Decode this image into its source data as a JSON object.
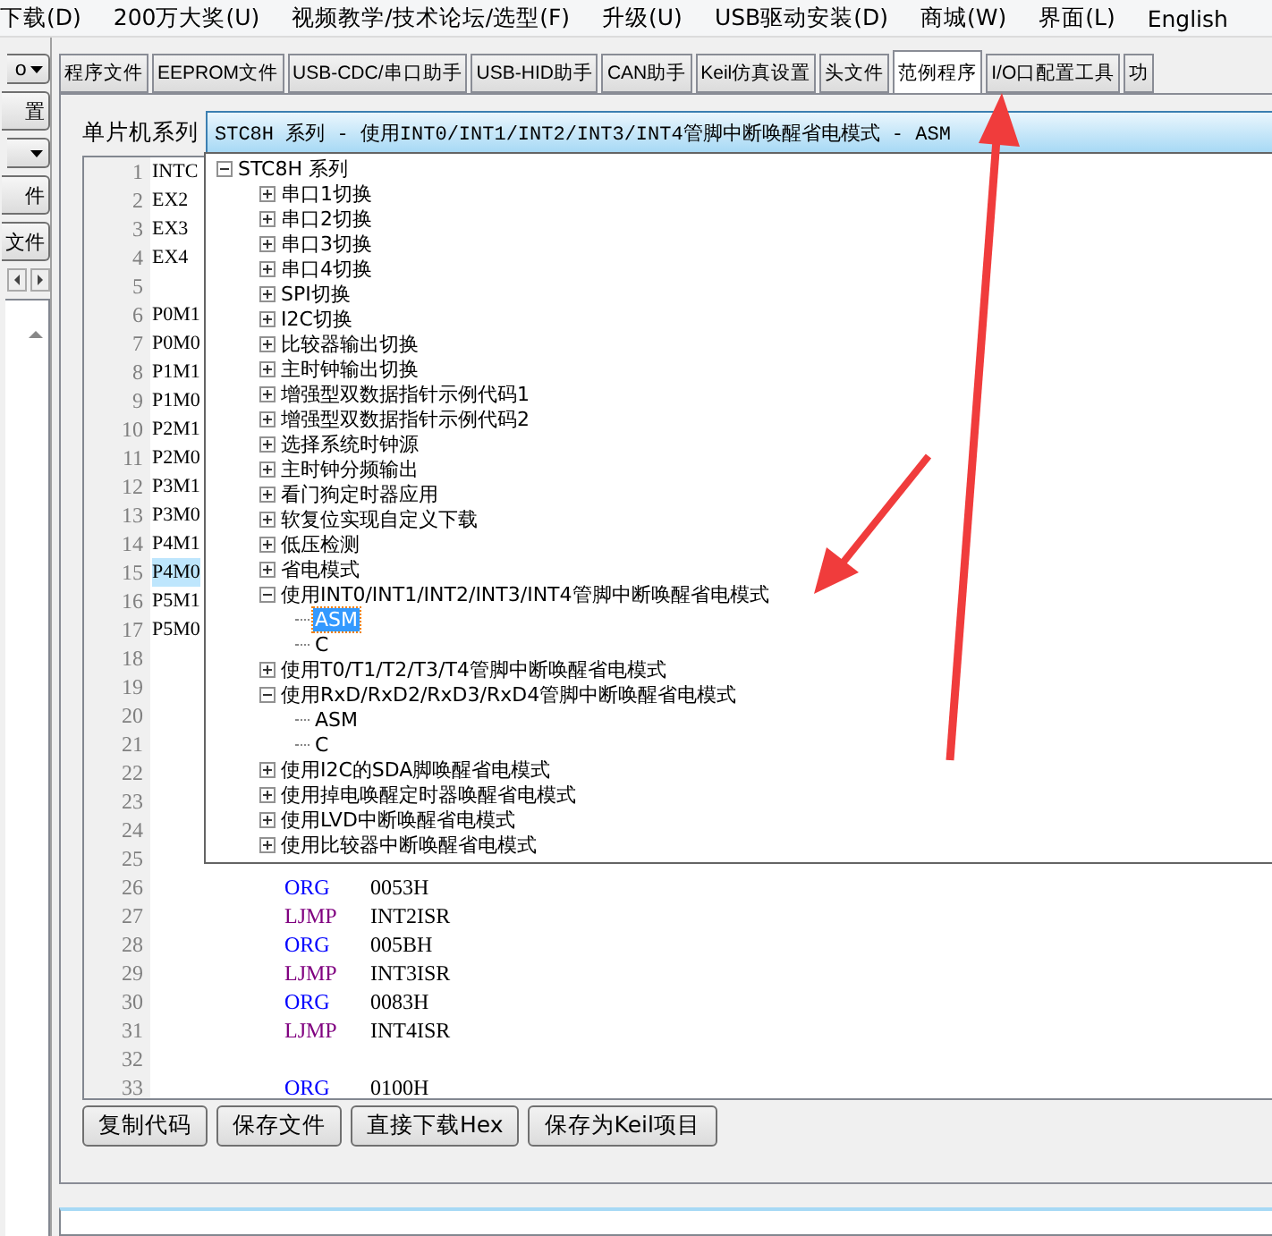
{
  "menu": [
    "下载(D)",
    "200万大奖(U)",
    "视频教学/技术论坛/选型(F)",
    "升级(U)",
    "USB驱动安装(D)",
    "商城(W)",
    "界面(L)",
    "English"
  ],
  "left_controls": [
    {
      "kind": "combo",
      "text": "o"
    },
    {
      "kind": "button",
      "text": "置"
    },
    {
      "kind": "combo"
    },
    {
      "kind": "button",
      "text": "件"
    },
    {
      "kind": "button",
      "text": "文件"
    },
    {
      "kind": "scroll"
    },
    {
      "kind": "list"
    }
  ],
  "tabs": [
    {
      "label": "程序文件",
      "selected": false
    },
    {
      "label": "EEPROM文件",
      "selected": false
    },
    {
      "label": "USB-CDC/串口助手",
      "selected": false
    },
    {
      "label": "USB-HID助手",
      "selected": false
    },
    {
      "label": "CAN助手",
      "selected": false
    },
    {
      "label": "Keil仿真设置",
      "selected": false
    },
    {
      "label": "头文件",
      "selected": false
    },
    {
      "label": "范例程序",
      "selected": true
    },
    {
      "label": "I/O口配置工具",
      "selected": false
    },
    {
      "label": "功",
      "selected": false
    }
  ],
  "series": {
    "label": "单片机系列",
    "value": "STC8H 系列 - 使用INT0/INT1/INT2/INT3/INT4管脚中断唤醒省电模式 - ASM"
  },
  "tree": {
    "label": "STC8H 系列",
    "expanded": true,
    "children": [
      {
        "label": "串口1切换",
        "expanded": false
      },
      {
        "label": "串口2切换",
        "expanded": false
      },
      {
        "label": "串口3切换",
        "expanded": false
      },
      {
        "label": "串口4切换",
        "expanded": false
      },
      {
        "label": "SPI切换",
        "expanded": false
      },
      {
        "label": "I2C切换",
        "expanded": false
      },
      {
        "label": "比较器输出切换",
        "expanded": false
      },
      {
        "label": "主时钟输出切换",
        "expanded": false
      },
      {
        "label": "增强型双数据指针示例代码1",
        "expanded": false
      },
      {
        "label": "增强型双数据指针示例代码2",
        "expanded": false
      },
      {
        "label": "选择系统时钟源",
        "expanded": false
      },
      {
        "label": "主时钟分频输出",
        "expanded": false
      },
      {
        "label": "看门狗定时器应用",
        "expanded": false
      },
      {
        "label": "软复位实现自定义下载",
        "expanded": false
      },
      {
        "label": "低压检测",
        "expanded": false
      },
      {
        "label": "省电模式",
        "expanded": false
      },
      {
        "label": "使用INT0/INT1/INT2/INT3/INT4管脚中断唤醒省电模式",
        "expanded": true,
        "children": [
          {
            "label": "ASM",
            "selected": true
          },
          {
            "label": "C",
            "selected": false
          }
        ]
      },
      {
        "label": "使用T0/T1/T2/T3/T4管脚中断唤醒省电模式",
        "expanded": false
      },
      {
        "label": "使用RxD/RxD2/RxD3/RxD4管脚中断唤醒省电模式",
        "expanded": true,
        "children": [
          {
            "label": "ASM",
            "selected": false
          },
          {
            "label": "C",
            "selected": false
          }
        ]
      },
      {
        "label": "使用I2C的SDA脚唤醒省电模式",
        "expanded": false
      },
      {
        "label": "使用掉电唤醒定时器唤醒省电模式",
        "expanded": false
      },
      {
        "label": "使用LVD中断唤醒省电模式",
        "expanded": false
      },
      {
        "label": "使用比较器中断唤醒省电模式",
        "expanded": false
      }
    ]
  },
  "code_lines": [
    {
      "number": "1",
      "text": "INTC",
      "current": false
    },
    {
      "number": "2",
      "text": "EX2",
      "current": false
    },
    {
      "number": "3",
      "text": "EX3",
      "current": false
    },
    {
      "number": "4",
      "text": "EX4",
      "current": false
    },
    {
      "number": "5",
      "current": false
    },
    {
      "number": "6",
      "text": "P0M1",
      "current": false
    },
    {
      "number": "7",
      "text": "P0M0",
      "current": false
    },
    {
      "number": "8",
      "text": "P1M1",
      "current": false
    },
    {
      "number": "9",
      "text": "P1M0",
      "current": false
    },
    {
      "number": "10",
      "text": "P2M1",
      "current": false
    },
    {
      "number": "11",
      "text": "P2M0",
      "current": false
    },
    {
      "number": "12",
      "text": "P3M1",
      "current": false
    },
    {
      "number": "13",
      "text": "P3M0",
      "current": false
    },
    {
      "number": "14",
      "text": "P4M1",
      "current": false
    },
    {
      "number": "15",
      "text": "P4M0",
      "current": true
    },
    {
      "number": "16",
      "text": "P5M1",
      "current": false
    },
    {
      "number": "17",
      "text": "P5M0",
      "current": false
    },
    {
      "number": "18",
      "current": false
    },
    {
      "number": "19",
      "current": false
    },
    {
      "number": "20",
      "current": false
    },
    {
      "number": "21",
      "current": false
    },
    {
      "number": "22",
      "current": false
    },
    {
      "number": "23",
      "current": false
    },
    {
      "number": "24",
      "current": false
    },
    {
      "number": "25",
      "current": false
    },
    {
      "number": "26",
      "kind": "directive",
      "op": "ORG",
      "arg": "0053H",
      "current": false
    },
    {
      "number": "27",
      "kind": "instruction",
      "op": "LJMP",
      "arg": "INT2ISR",
      "current": false
    },
    {
      "number": "28",
      "kind": "directive",
      "op": "ORG",
      "arg": "005BH",
      "current": false
    },
    {
      "number": "29",
      "kind": "instruction",
      "op": "LJMP",
      "arg": "INT3ISR",
      "current": false
    },
    {
      "number": "30",
      "kind": "directive",
      "op": "ORG",
      "arg": "0083H",
      "current": false
    },
    {
      "number": "31",
      "kind": "instruction",
      "op": "LJMP",
      "arg": "INT4ISR",
      "current": false
    },
    {
      "number": "32",
      "current": false
    },
    {
      "number": "33",
      "kind": "directive",
      "op": "ORG",
      "arg": "0100H",
      "current": false
    }
  ],
  "buttons": [
    "复制代码",
    "保存文件",
    "直接下载Hex",
    "保存为Keil项目"
  ]
}
